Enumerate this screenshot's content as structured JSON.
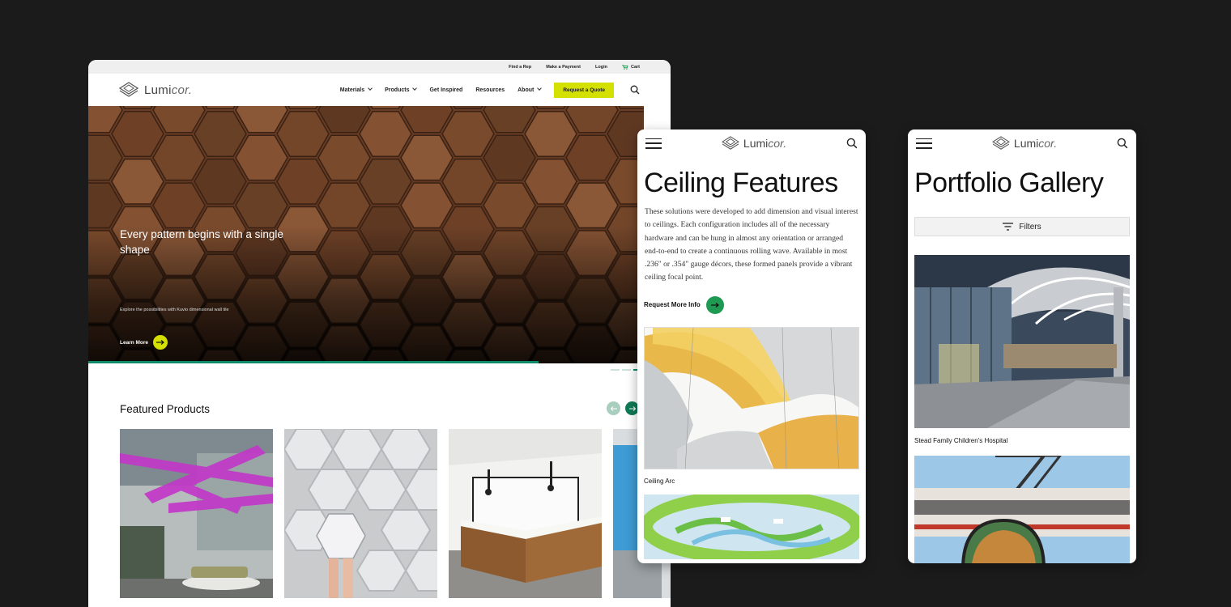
{
  "colors": {
    "background": "#1b1b1b",
    "accent_yellow": "#d4e000",
    "accent_green": "#1f9a52",
    "progress_teal": "#0f8a6a"
  },
  "desktop": {
    "utility_nav": [
      "Find a Rep",
      "Make a Payment",
      "Login",
      "Cart"
    ],
    "logo": {
      "main": "Lumi",
      "suffix": "cor."
    },
    "nav": {
      "items": [
        "Materials",
        "Products",
        "Get Inspired",
        "Resources",
        "About"
      ],
      "quote_button": "Request a Quote"
    },
    "hero": {
      "title": "Every pattern begins with a single shape",
      "subtitle": "Explore the possibilities with Kuvio dimensional wall tile",
      "cta": "Learn More",
      "progress": 0.81
    },
    "featured": {
      "title": "Featured Products"
    }
  },
  "mobile_ceiling": {
    "logo": {
      "main": "Lumi",
      "suffix": "cor."
    },
    "title": "Ceiling Features",
    "body": "These solutions were developed to add dimension and visual interest to ceilings. Each configuration includes all of the necessary hardware and can be hung in almost any orientation or arranged end-to-end to create a continuous rolling wave. Available in most .236\" or .354\" gauge décors, these formed panels provide a vibrant ceiling focal point.",
    "cta": "Request More Info",
    "caption": "Ceiling Arc"
  },
  "mobile_portfolio": {
    "logo": {
      "main": "Lumi",
      "suffix": "cor."
    },
    "title": "Portfolio Gallery",
    "filters_label": "Filters",
    "caption": "Stead Family Children's Hospital"
  }
}
